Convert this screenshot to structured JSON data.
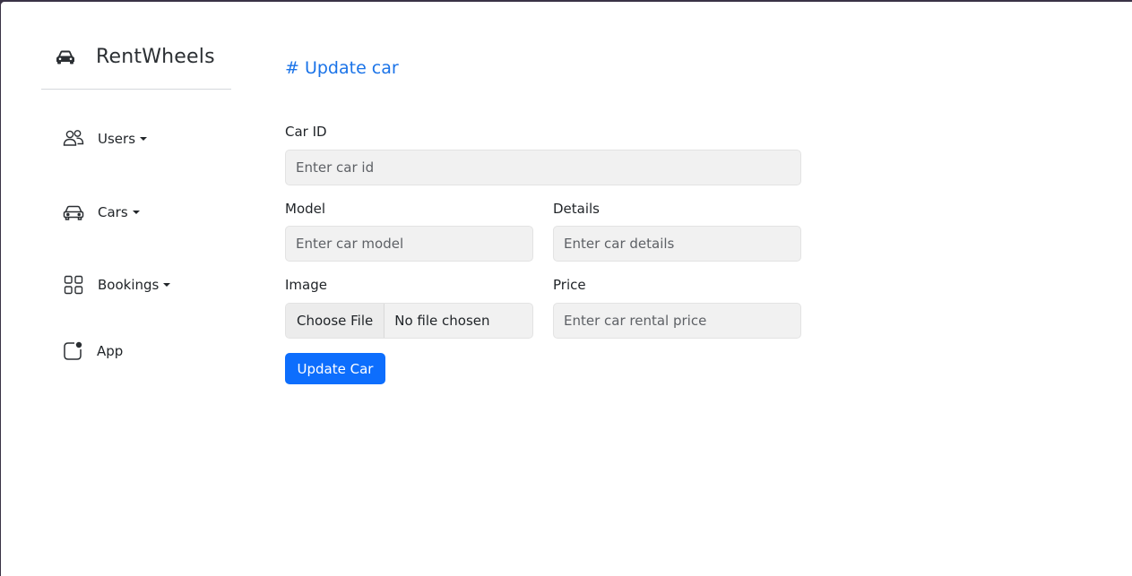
{
  "app": {
    "name": "RentWheels"
  },
  "sidebar": {
    "items": [
      {
        "label": "Users",
        "icon": "users-icon",
        "dropdown": true
      },
      {
        "label": "Cars",
        "icon": "car-icon",
        "dropdown": true
      },
      {
        "label": "Bookings",
        "icon": "grid-icon",
        "dropdown": true
      },
      {
        "label": "App",
        "icon": "app-notification-icon",
        "dropdown": false
      }
    ]
  },
  "main": {
    "title": "# Update car",
    "form": {
      "car_id": {
        "label": "Car ID",
        "placeholder": "Enter car id"
      },
      "model": {
        "label": "Model",
        "placeholder": "Enter car model"
      },
      "details": {
        "label": "Details",
        "placeholder": "Enter car details"
      },
      "image": {
        "label": "Image",
        "button_label": "Choose File",
        "status": "No file chosen"
      },
      "price": {
        "label": "Price",
        "placeholder": "Enter car rental price"
      },
      "submit_label": "Update Car"
    }
  },
  "colors": {
    "accent": "#1a73e8",
    "primary_button": "#0d6efd",
    "input_background": "#f1f1f1"
  }
}
